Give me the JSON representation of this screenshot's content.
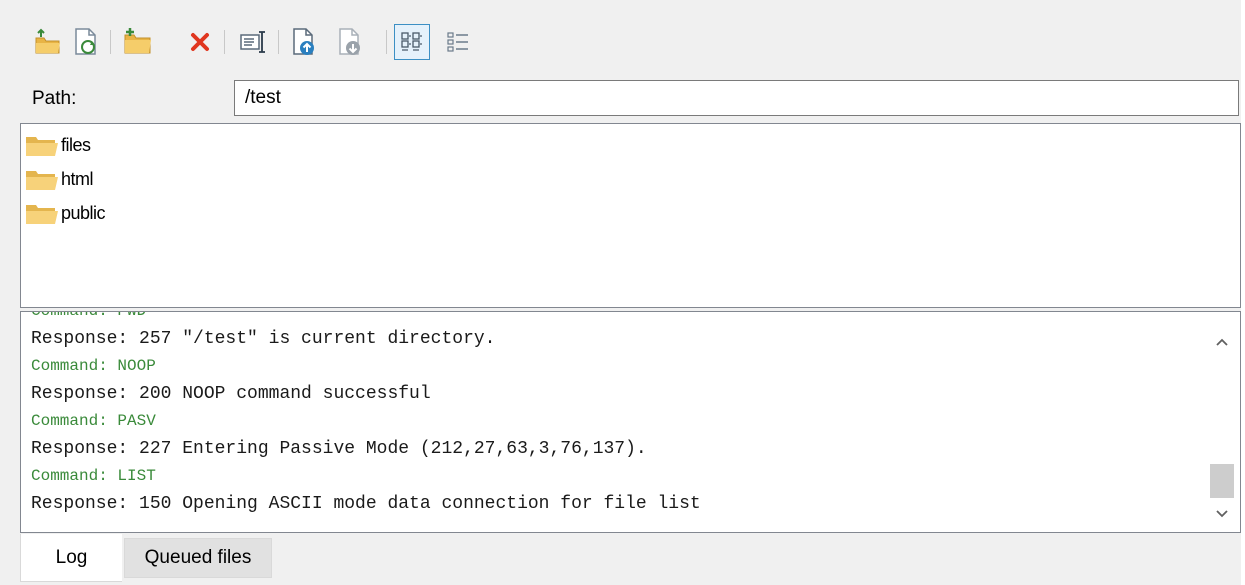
{
  "toolbar": {
    "buttons": [
      {
        "icon": "parent-folder-icon",
        "name": "parent-folder-button"
      },
      {
        "icon": "refresh-icon",
        "name": "refresh-button"
      },
      {
        "icon": "new-folder-icon",
        "name": "new-folder-button"
      },
      {
        "icon": "delete-icon",
        "name": "delete-button"
      },
      {
        "icon": "rename-icon",
        "name": "rename-button"
      },
      {
        "icon": "upload-icon",
        "name": "upload-button"
      },
      {
        "icon": "download-icon",
        "name": "download-button"
      },
      {
        "icon": "icon-view-icon",
        "name": "icon-view-button",
        "active": true
      },
      {
        "icon": "detail-view-icon",
        "name": "detail-view-button"
      }
    ]
  },
  "path": {
    "label": "Path:",
    "value": "/test"
  },
  "files": [
    {
      "name": "files",
      "icon": "folder-icon"
    },
    {
      "name": "html",
      "icon": "folder-icon"
    },
    {
      "name": "public",
      "icon": "folder-icon"
    }
  ],
  "log": {
    "lines": [
      {
        "type": "cmd",
        "text": "Command: PWD"
      },
      {
        "type": "resp",
        "text": "Response: 257 \"/test\" is current directory."
      },
      {
        "type": "cmd",
        "text": "Command: NOOP"
      },
      {
        "type": "resp",
        "text": "Response: 200 NOOP command successful"
      },
      {
        "type": "cmd",
        "text": "Command: PASV"
      },
      {
        "type": "resp",
        "text": "Response: 227 Entering Passive Mode (212,27,63,3,76,137)."
      },
      {
        "type": "cmd",
        "text": "Command: LIST"
      },
      {
        "type": "resp",
        "text": "Response: 150 Opening ASCII mode data connection for file list"
      }
    ]
  },
  "tabs": {
    "log": "Log",
    "queued": "Queued files"
  },
  "colors": {
    "command": "#3a8a3a",
    "response": "#1a1a1a",
    "folder": "#f2c25a",
    "delete": "#e0361f",
    "accent": "#3c8fc4"
  }
}
